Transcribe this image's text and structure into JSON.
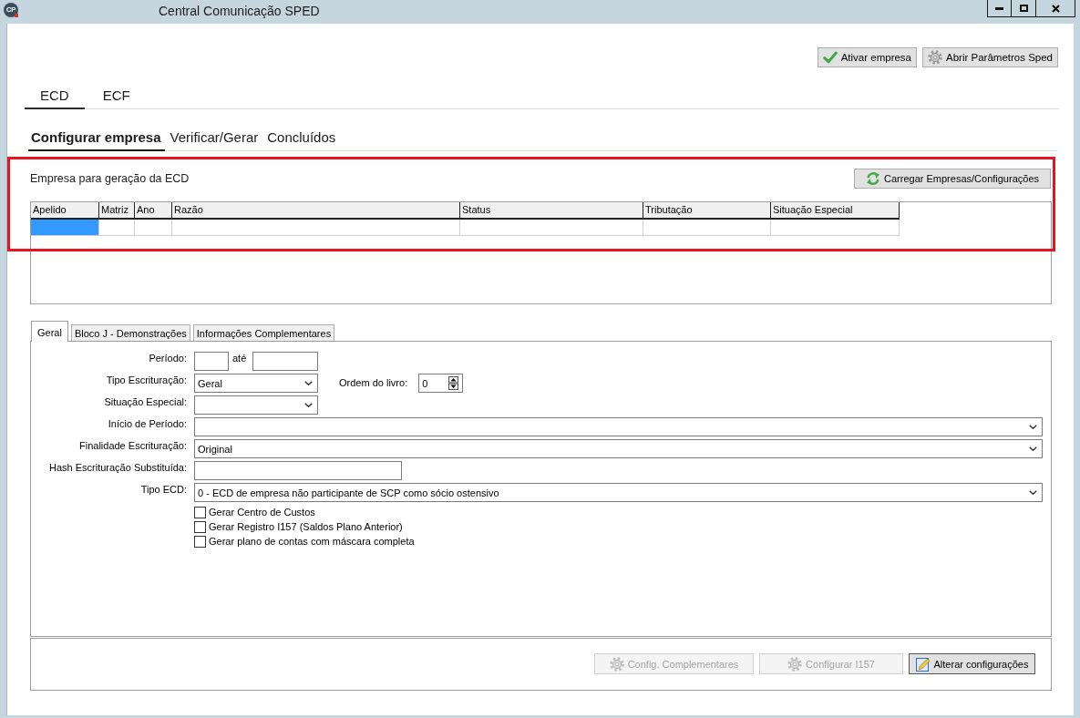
{
  "window": {
    "logo_text": "CP",
    "title": "Central Comunicação SPED",
    "controls": [
      {
        "kind": "minimize"
      },
      {
        "kind": "maximize"
      },
      {
        "kind": "close"
      }
    ]
  },
  "toolbar": {
    "buttons": [
      {
        "kind": "confirm",
        "label": "Ativar empresa"
      },
      {
        "kind": "settings",
        "label": "Abrir Parâmetros Sped"
      }
    ]
  },
  "module_tabs": [
    {
      "label": "ECD",
      "selected": true
    },
    {
      "label": "ECF",
      "selected": false
    }
  ],
  "step_tabs": [
    {
      "label": "Configurar empresa",
      "selected": true
    },
    {
      "label": "Verificar/Gerar",
      "selected": false
    },
    {
      "label": "Concluídos",
      "selected": false
    }
  ],
  "company_panel": {
    "highlighted": true,
    "title": "Empresa para geração da ECD",
    "load_button": {
      "kind": "reload",
      "label": "Carregar Empresas/Configurações"
    },
    "table": {
      "columns": [
        "Apelido",
        "Matriz",
        "Ano",
        "Razão",
        "Status",
        "Tributação",
        "Situação Especial"
      ],
      "rows": [
        {
          "cells": [
            {
              "selected": true
            },
            {
              "selected": false
            },
            {
              "selected": false
            },
            {
              "selected": false
            },
            {
              "selected": false
            },
            {
              "selected": false
            },
            {
              "selected": false
            }
          ]
        }
      ]
    }
  },
  "detail_tabs": [
    {
      "label": "Geral",
      "selected": true
    },
    {
      "label": "Bloco J - Demonstrações",
      "selected": false
    },
    {
      "label": "Informações Complementares",
      "selected": false
    }
  ],
  "general_form": {
    "fields": [
      {
        "kind": "range",
        "label": "Período:",
        "connector": "até"
      },
      {
        "kind": "select",
        "label": "Tipo Escrituração:",
        "value": "Geral",
        "side": {
          "kind": "spinner",
          "label": "Ordem do livro:",
          "value": "0"
        }
      },
      {
        "kind": "select",
        "label": "Situação Especial:"
      },
      {
        "kind": "wide-select",
        "label": "Início de Período:"
      },
      {
        "kind": "wide-select",
        "label": "Finalidade Escrituração:",
        "value": "Original"
      },
      {
        "kind": "text",
        "label": "Hash Escrituração Substituída:"
      },
      {
        "kind": "wide-select",
        "label": "Tipo ECD:",
        "value": "0 - ECD de empresa não participante de SCP como sócio ostensivo"
      }
    ],
    "options": [
      {
        "label": "Gerar Centro de Custos",
        "checked": false
      },
      {
        "label": "Gerar Registro I157 (Saldos Plano Anterior)",
        "checked": false
      },
      {
        "label": "Gerar plano de contas com máscara completa",
        "checked": false
      }
    ]
  },
  "footer_buttons": [
    {
      "kind": "settings",
      "label": "Config. Complementares",
      "disabled": true
    },
    {
      "kind": "settings",
      "label": "Configurar I157",
      "disabled": true
    },
    {
      "kind": "edit",
      "label": "Alterar configurações",
      "disabled": false
    }
  ]
}
